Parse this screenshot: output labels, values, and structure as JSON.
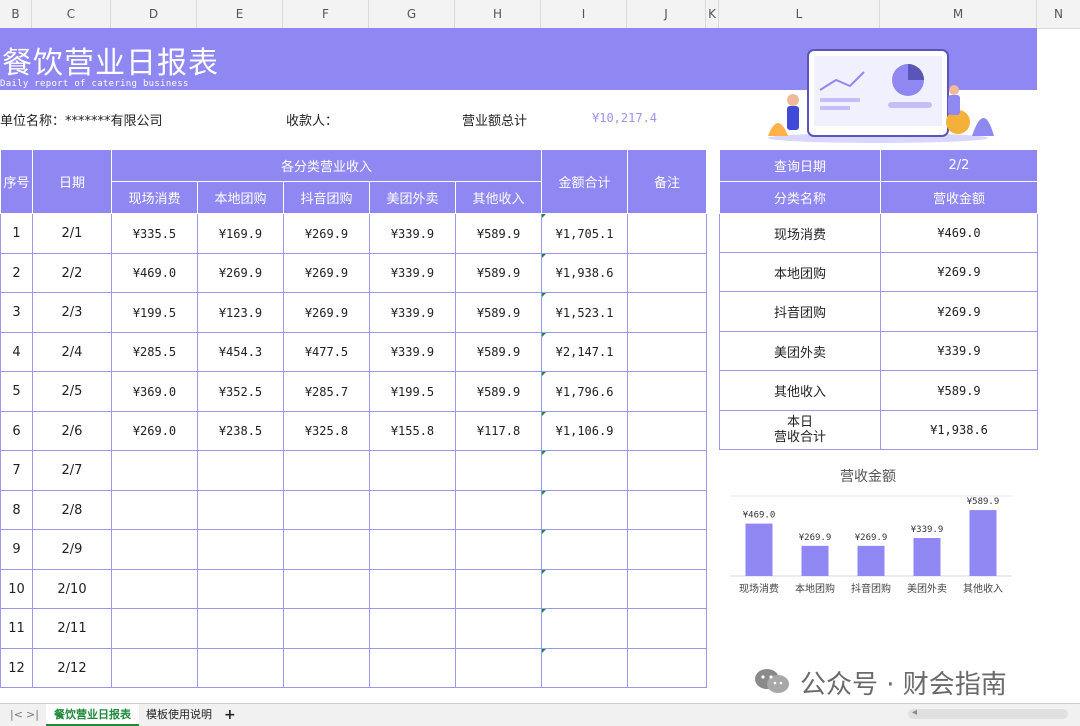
{
  "columns": [
    "B",
    "C",
    "D",
    "E",
    "F",
    "G",
    "H",
    "I",
    "J",
    "K",
    "L",
    "M",
    "N"
  ],
  "banner": {
    "title": "餐饮营业日报表",
    "subtitle": "Daily report of catering business"
  },
  "info": {
    "unit_label": "单位名称：*******有限公司",
    "payee_label": "收款人：",
    "total_label": "营业额总计",
    "total_value": "¥10,217.4"
  },
  "table": {
    "h_index": "序号",
    "h_date": "日期",
    "h_group": "各分类营业收入",
    "h_sub": [
      "现场消费",
      "本地团购",
      "抖音团购",
      "美团外卖",
      "其他收入"
    ],
    "h_total": "金额合计",
    "h_note": "备注",
    "rows": [
      {
        "idx": "1",
        "date": "2/1",
        "v": [
          "¥335.5",
          "¥169.9",
          "¥269.9",
          "¥339.9",
          "¥589.9"
        ],
        "total": "¥1,705.1"
      },
      {
        "idx": "2",
        "date": "2/2",
        "v": [
          "¥469.0",
          "¥269.9",
          "¥269.9",
          "¥339.9",
          "¥589.9"
        ],
        "total": "¥1,938.6"
      },
      {
        "idx": "3",
        "date": "2/3",
        "v": [
          "¥199.5",
          "¥123.9",
          "¥269.9",
          "¥339.9",
          "¥589.9"
        ],
        "total": "¥1,523.1"
      },
      {
        "idx": "4",
        "date": "2/4",
        "v": [
          "¥285.5",
          "¥454.3",
          "¥477.5",
          "¥339.9",
          "¥589.9"
        ],
        "total": "¥2,147.1"
      },
      {
        "idx": "5",
        "date": "2/5",
        "v": [
          "¥369.0",
          "¥352.5",
          "¥285.7",
          "¥199.5",
          "¥589.9"
        ],
        "total": "¥1,796.6"
      },
      {
        "idx": "6",
        "date": "2/6",
        "v": [
          "¥269.0",
          "¥238.5",
          "¥325.8",
          "¥155.8",
          "¥117.8"
        ],
        "total": "¥1,106.9"
      },
      {
        "idx": "7",
        "date": "2/7",
        "v": [
          "",
          "",
          "",
          "",
          ""
        ],
        "total": ""
      },
      {
        "idx": "8",
        "date": "2/8",
        "v": [
          "",
          "",
          "",
          "",
          ""
        ],
        "total": ""
      },
      {
        "idx": "9",
        "date": "2/9",
        "v": [
          "",
          "",
          "",
          "",
          ""
        ],
        "total": ""
      },
      {
        "idx": "10",
        "date": "2/10",
        "v": [
          "",
          "",
          "",
          "",
          ""
        ],
        "total": ""
      },
      {
        "idx": "11",
        "date": "2/11",
        "v": [
          "",
          "",
          "",
          "",
          ""
        ],
        "total": ""
      },
      {
        "idx": "12",
        "date": "2/12",
        "v": [
          "",
          "",
          "",
          "",
          ""
        ],
        "total": ""
      }
    ]
  },
  "summary": {
    "query_label": "查询日期",
    "query_value": "2/2",
    "h_name": "分类名称",
    "h_amount": "营收金额",
    "rows": [
      {
        "name": "现场消费",
        "amount": "¥469.0"
      },
      {
        "name": "本地团购",
        "amount": "¥269.9"
      },
      {
        "name": "抖音团购",
        "amount": "¥269.9"
      },
      {
        "name": "美团外卖",
        "amount": "¥339.9"
      },
      {
        "name": "其他收入",
        "amount": "¥589.9"
      }
    ],
    "total_name_line1": "本日",
    "total_name_line2": "营收合计",
    "total_amount": "¥1,938.6"
  },
  "chart_data": {
    "type": "bar",
    "title": "营收金额",
    "categories": [
      "现场消费",
      "本地团购",
      "抖音团购",
      "美团外卖",
      "其他收入"
    ],
    "values": [
      469.0,
      269.9,
      269.9,
      339.9,
      589.9
    ],
    "value_labels": [
      "¥469.0",
      "¥269.9",
      "¥269.9",
      "¥339.9",
      "¥589.9"
    ],
    "ylim": [
      0,
      650
    ],
    "bar_color": "#8f87f2",
    "grid": false
  },
  "sheet_tabs": {
    "active": "餐饮营业日报表",
    "other": "模板使用说明",
    "add": "+"
  },
  "watermark": "公众号 · 财会指南",
  "colors": {
    "accent": "#8f87f2",
    "border": "#9c97f0",
    "total_text": "#9a93f2"
  }
}
